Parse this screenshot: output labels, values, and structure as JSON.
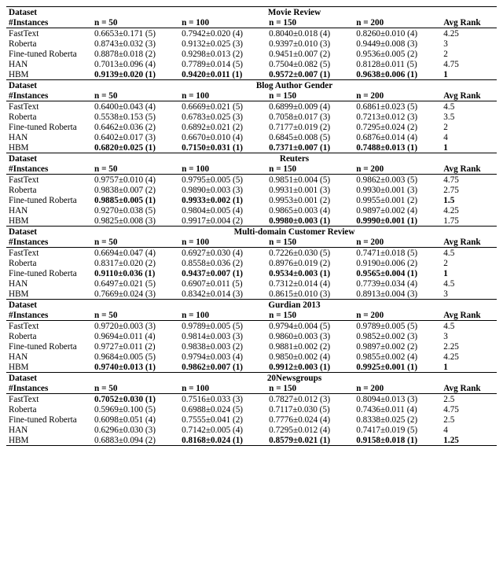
{
  "header": {
    "dataset_label": "Dataset",
    "instances_label": "#Instances",
    "avg_rank_label": "Avg Rank",
    "n_labels": [
      "n = 50",
      "n = 100",
      "n = 150",
      "n = 200"
    ]
  },
  "methods": [
    "FastText",
    "Roberta",
    "Fine-tuned Roberta",
    "HAN",
    "HBM"
  ],
  "chart_data": {
    "type": "table",
    "datasets": [
      {
        "name": "Movie Review",
        "rows": [
          {
            "method": "FastText",
            "cells": [
              "0.6653±0.171 (5)",
              "0.7942±0.020 (4)",
              "0.8040±0.018 (4)",
              "0.8260±0.010 (4)"
            ],
            "rank": "4.25",
            "bold": [
              false,
              false,
              false,
              false
            ],
            "rank_bold": false
          },
          {
            "method": "Roberta",
            "cells": [
              "0.8743±0.032 (3)",
              "0.9132±0.025 (3)",
              "0.9397±0.010 (3)",
              "0.9449±0.008 (3)"
            ],
            "rank": "3",
            "bold": [
              false,
              false,
              false,
              false
            ],
            "rank_bold": false
          },
          {
            "method": "Fine-tuned Roberta",
            "cells": [
              "0.8878±0.018 (2)",
              "0.9298±0.013 (2)",
              "0.9451±0.007 (2)",
              "0.9536±0.005 (2)"
            ],
            "rank": "2",
            "bold": [
              false,
              false,
              false,
              false
            ],
            "rank_bold": false
          },
          {
            "method": "HAN",
            "cells": [
              "0.7013±0.096 (4)",
              "0.7789±0.014 (5)",
              "0.7504±0.082 (5)",
              "0.8128±0.011 (5)"
            ],
            "rank": "4.75",
            "bold": [
              false,
              false,
              false,
              false
            ],
            "rank_bold": false
          },
          {
            "method": "HBM",
            "cells": [
              "0.9139±0.020 (1)",
              "0.9420±0.011 (1)",
              "0.9572±0.007 (1)",
              "0.9638±0.006 (1)"
            ],
            "rank": "1",
            "bold": [
              true,
              true,
              true,
              true
            ],
            "rank_bold": true
          }
        ]
      },
      {
        "name": "Blog Author Gender",
        "rows": [
          {
            "method": "FastText",
            "cells": [
              "0.6400±0.043 (4)",
              "0.6669±0.021 (5)",
              "0.6899±0.009 (4)",
              "0.6861±0.023 (5)"
            ],
            "rank": "4.5",
            "bold": [
              false,
              false,
              false,
              false
            ],
            "rank_bold": false
          },
          {
            "method": "Roberta",
            "cells": [
              "0.5538±0.153 (5)",
              "0.6783±0.025 (3)",
              "0.7058±0.017 (3)",
              "0.7213±0.012 (3)"
            ],
            "rank": "3.5",
            "bold": [
              false,
              false,
              false,
              false
            ],
            "rank_bold": false
          },
          {
            "method": "Fine-tuned Roberta",
            "cells": [
              "0.6462±0.036 (2)",
              "0.6892±0.021 (2)",
              "0.7177±0.019 (2)",
              "0.7295±0.024 (2)"
            ],
            "rank": "2",
            "bold": [
              false,
              false,
              false,
              false
            ],
            "rank_bold": false
          },
          {
            "method": "HAN",
            "cells": [
              "0.6402±0.017 (3)",
              "0.6670±0.010 (4)",
              "0.6845±0.008 (5)",
              "0.6876±0.014 (4)"
            ],
            "rank": "4",
            "bold": [
              false,
              false,
              false,
              false
            ],
            "rank_bold": false
          },
          {
            "method": "HBM",
            "cells": [
              "0.6820±0.025 (1)",
              "0.7150±0.031 (1)",
              "0.7371±0.007 (1)",
              "0.7488±0.013 (1)"
            ],
            "rank": "1",
            "bold": [
              true,
              true,
              true,
              true
            ],
            "rank_bold": true
          }
        ]
      },
      {
        "name": "Reuters",
        "rows": [
          {
            "method": "FastText",
            "cells": [
              "0.9757±0.010 (4)",
              "0.9795±0.005 (5)",
              "0.9851±0.004 (5)",
              "0.9862±0.003 (5)"
            ],
            "rank": "4.75",
            "bold": [
              false,
              false,
              false,
              false
            ],
            "rank_bold": false
          },
          {
            "method": "Roberta",
            "cells": [
              "0.9838±0.007 (2)",
              "0.9890±0.003 (3)",
              "0.9931±0.001 (3)",
              "0.9930±0.001 (3)"
            ],
            "rank": "2.75",
            "bold": [
              false,
              false,
              false,
              false
            ],
            "rank_bold": false
          },
          {
            "method": "Fine-tuned Roberta",
            "cells": [
              "0.9885±0.005 (1)",
              "0.9933±0.002 (1)",
              "0.9953±0.001 (2)",
              "0.9955±0.001 (2)"
            ],
            "rank": "1.5",
            "bold": [
              true,
              true,
              false,
              false
            ],
            "rank_bold": true
          },
          {
            "method": "HAN",
            "cells": [
              "0.9270±0.038 (5)",
              "0.9804±0.005 (4)",
              "0.9865±0.003 (4)",
              "0.9897±0.002 (4)"
            ],
            "rank": "4.25",
            "bold": [
              false,
              false,
              false,
              false
            ],
            "rank_bold": false
          },
          {
            "method": "HBM",
            "cells": [
              "0.9825±0.008 (3)",
              "0.9917±0.004 (2)",
              "0.9980±0.003 (1)",
              "0.9990±0.001 (1)"
            ],
            "rank": "1.75",
            "bold": [
              false,
              false,
              true,
              true
            ],
            "rank_bold": false
          }
        ]
      },
      {
        "name": "Multi-domain Customer Review",
        "rows": [
          {
            "method": "FastText",
            "cells": [
              "0.6694±0.047 (4)",
              "0.6927±0.030 (4)",
              "0.7226±0.030 (5)",
              "0.7471±0.018 (5)"
            ],
            "rank": "4.5",
            "bold": [
              false,
              false,
              false,
              false
            ],
            "rank_bold": false
          },
          {
            "method": "Roberta",
            "cells": [
              "0.8317±0.020 (2)",
              "0.8558±0.036 (2)",
              "0.8976±0.019 (2)",
              "0.9190±0.006 (2)"
            ],
            "rank": "2",
            "bold": [
              false,
              false,
              false,
              false
            ],
            "rank_bold": false
          },
          {
            "method": "Fine-tuned Roberta",
            "cells": [
              "0.9110±0.036 (1)",
              "0.9437±0.007 (1)",
              "0.9534±0.003 (1)",
              "0.9565±0.004 (1)"
            ],
            "rank": "1",
            "bold": [
              true,
              true,
              true,
              true
            ],
            "rank_bold": true
          },
          {
            "method": "HAN",
            "cells": [
              "0.6497±0.021 (5)",
              "0.6907±0.011 (5)",
              "0.7312±0.014 (4)",
              "0.7739±0.034 (4)"
            ],
            "rank": "4.5",
            "bold": [
              false,
              false,
              false,
              false
            ],
            "rank_bold": false
          },
          {
            "method": "HBM",
            "cells": [
              "0.7669±0.024 (3)",
              "0.8342±0.014 (3)",
              "0.8615±0.010 (3)",
              "0.8913±0.004 (3)"
            ],
            "rank": "3",
            "bold": [
              false,
              false,
              false,
              false
            ],
            "rank_bold": false
          }
        ]
      },
      {
        "name": "Gurdian 2013",
        "rows": [
          {
            "method": "FastText",
            "cells": [
              "0.9720±0.003 (3)",
              "0.9789±0.005 (5)",
              "0.9794±0.004 (5)",
              "0.9789±0.005 (5)"
            ],
            "rank": "4.5",
            "bold": [
              false,
              false,
              false,
              false
            ],
            "rank_bold": false
          },
          {
            "method": "Roberta",
            "cells": [
              "0.9694±0.011 (4)",
              "0.9814±0.003 (3)",
              "0.9860±0.003 (3)",
              "0.9852±0.002 (3)"
            ],
            "rank": "3",
            "bold": [
              false,
              false,
              false,
              false
            ],
            "rank_bold": false
          },
          {
            "method": "Fine-tuned Roberta",
            "cells": [
              "0.9727±0.011 (2)",
              "0.9838±0.003 (2)",
              "0.9881±0.002 (2)",
              "0.9897±0.002 (2)"
            ],
            "rank": "2.25",
            "bold": [
              false,
              false,
              false,
              false
            ],
            "rank_bold": false
          },
          {
            "method": "HAN",
            "cells": [
              "0.9684±0.005 (5)",
              "0.9794±0.003 (4)",
              "0.9850±0.002 (4)",
              "0.9855±0.002 (4)"
            ],
            "rank": "4.25",
            "bold": [
              false,
              false,
              false,
              false
            ],
            "rank_bold": false
          },
          {
            "method": "HBM",
            "cells": [
              "0.9740±0.013 (1)",
              "0.9862±0.007 (1)",
              "0.9912±0.003 (1)",
              "0.9925±0.001 (1)"
            ],
            "rank": "1",
            "bold": [
              true,
              true,
              true,
              true
            ],
            "rank_bold": true
          }
        ]
      },
      {
        "name": "20Newsgroups",
        "rows": [
          {
            "method": "FastText",
            "cells": [
              "0.7052±0.030 (1)",
              "0.7516±0.033 (3)",
              "0.7827±0.012 (3)",
              "0.8094±0.013 (3)"
            ],
            "rank": "2.5",
            "bold": [
              true,
              false,
              false,
              false
            ],
            "rank_bold": false
          },
          {
            "method": "Roberta",
            "cells": [
              "0.5969±0.100 (5)",
              "0.6988±0.024 (5)",
              "0.7117±0.030 (5)",
              "0.7436±0.011 (4)"
            ],
            "rank": "4.75",
            "bold": [
              false,
              false,
              false,
              false
            ],
            "rank_bold": false
          },
          {
            "method": "Fine-tuned Roberta",
            "cells": [
              "0.6098±0.051 (4)",
              "0.7555±0.041 (2)",
              "0.7776±0.024 (4)",
              "0.8338±0.025 (2)"
            ],
            "rank": "2.5",
            "bold": [
              false,
              false,
              false,
              false
            ],
            "rank_bold": false
          },
          {
            "method": "HAN",
            "cells": [
              "0.6296±0.030 (3)",
              "0.7142±0.005 (4)",
              "0.7295±0.012 (4)",
              "0.7417±0.019 (5)"
            ],
            "rank": "4",
            "bold": [
              false,
              false,
              false,
              false
            ],
            "rank_bold": false
          },
          {
            "method": "HBM",
            "cells": [
              "0.6883±0.094 (2)",
              "0.8168±0.024 (1)",
              "0.8579±0.021 (1)",
              "0.9158±0.018 (1)"
            ],
            "rank": "1.25",
            "bold": [
              false,
              true,
              true,
              true
            ],
            "rank_bold": true
          }
        ]
      }
    ]
  }
}
